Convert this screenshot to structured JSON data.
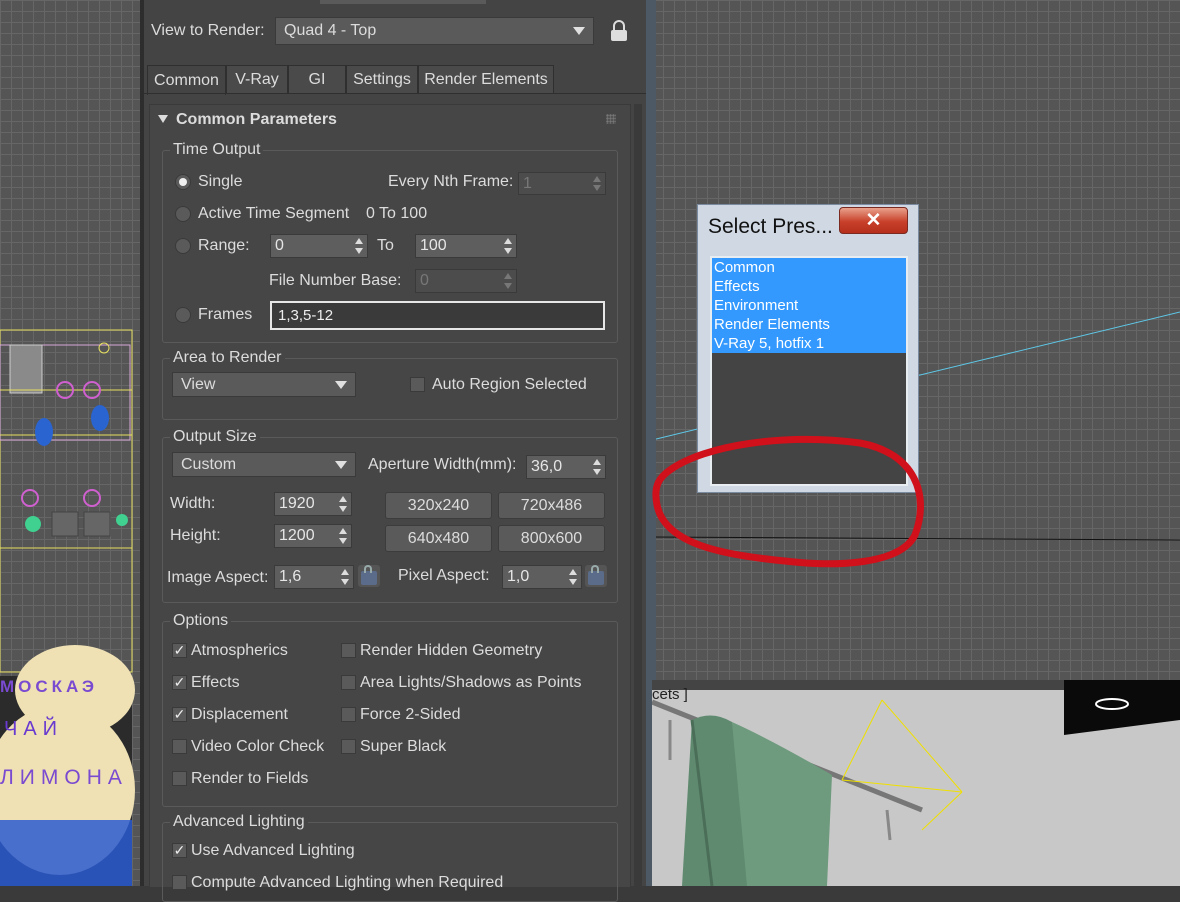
{
  "render_setup": {
    "view_to_render_label": "View to Render:",
    "view_to_render_value": "Quad 4 - Top",
    "tabs": [
      "Common",
      "V-Ray",
      "GI",
      "Settings",
      "Render Elements"
    ],
    "rollout_title": "Common Parameters",
    "time_output": {
      "title": "Time Output",
      "single": "Single",
      "every_nth_label": "Every Nth Frame:",
      "every_nth_value": "1",
      "active_segment": "Active Time Segment",
      "active_segment_range": "0 To 100",
      "range": "Range:",
      "range_from": "0",
      "range_to_label": "To",
      "range_to": "100",
      "file_number_base_label": "File Number Base:",
      "file_number_base_value": "0",
      "frames": "Frames",
      "frames_value": "1,3,5-12"
    },
    "area_to_render": {
      "title": "Area to Render",
      "value": "View",
      "auto_region": "Auto Region Selected"
    },
    "output_size": {
      "title": "Output Size",
      "preset": "Custom",
      "aperture_label": "Aperture Width(mm):",
      "aperture_value": "36,0",
      "width_label": "Width:",
      "width_value": "1920",
      "height_label": "Height:",
      "height_value": "1200",
      "presets": [
        "320x240",
        "720x486",
        "640x480",
        "800x600"
      ],
      "image_aspect_label": "Image Aspect:",
      "image_aspect_value": "1,6",
      "pixel_aspect_label": "Pixel Aspect:",
      "pixel_aspect_value": "1,0"
    },
    "options": {
      "title": "Options",
      "atmospherics": "Atmospherics",
      "effects": "Effects",
      "displacement": "Displacement",
      "video_color_check": "Video Color Check",
      "render_to_fields": "Render to Fields",
      "render_hidden": "Render Hidden Geometry",
      "area_lights": "Area Lights/Shadows as Points",
      "force_2_sided": "Force 2-Sided",
      "super_black": "Super Black"
    },
    "advanced_lighting": {
      "title": "Advanced Lighting",
      "use_advanced": "Use Advanced Lighting",
      "compute_advanced": "Compute Advanced Lighting when Required"
    }
  },
  "select_preset": {
    "title": "Select Pres...",
    "close_glyph": "✕",
    "items": [
      "Common",
      "Effects",
      "Environment",
      "Render Elements",
      "V-Ray 5, hotfix 1"
    ]
  },
  "viewport": {
    "label": "cets ]",
    "left_texts": [
      "МОСКАЭ",
      "ЧАЙ",
      "ЛИМОНА"
    ]
  },
  "colors": {
    "annotation_circle": "#d0101a",
    "selection_blue": "#3399ff"
  }
}
